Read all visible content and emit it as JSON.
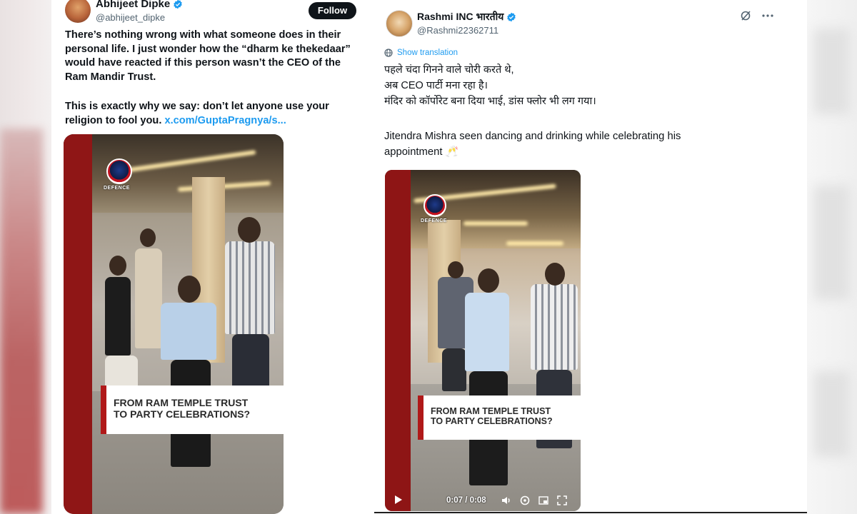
{
  "left_tweet": {
    "author_name": "Abhijeet Dipke",
    "handle": "@abhijeet_dipke",
    "follow_label": "Follow",
    "paragraph_1": "There’s nothing wrong with what someone does in their personal life. I just wonder how the “dharm ke thekedaar” would have reacted if this person wasn’t the CEO of the Ram Mandir Trust.",
    "paragraph_2": "This is exactly why we say: don’t let anyone use your religion to fool you.",
    "link": "x.com/GuptaPragnya/s...",
    "video": {
      "caption_line_1": "FROM RAM TEMPLE TRUST",
      "caption_line_2": "TO PARTY CELEBRATIONS?",
      "logo_text": "DEFENCE"
    }
  },
  "right_tweet": {
    "author_name": "Rashmi INC भारतीय",
    "handle": "@Rashmi22362711",
    "show_translation": "Show translation",
    "hindi_lines": [
      "पहले चंदा गिनने वाले चोरी करते थे,",
      "अब CEO पार्टी मना रहा है।",
      "मंदिर को कॉर्पोरेट बना दिया भाई, डांस फ्लोर भी लग गया।"
    ],
    "body_line_1": "Jitendra Mishra seen dancing and drinking while celebrating his",
    "body_line_2": "appointment 🥂",
    "video": {
      "caption_line_1": "FROM RAM TEMPLE TRUST",
      "caption_line_2": "TO PARTY CELEBRATIONS?",
      "logo_text": "DEFENCE",
      "time": "0:07 / 0:08"
    }
  },
  "icons": {
    "verified": "verified-badge-icon",
    "grok": "grok-icon",
    "more": "more-options-icon",
    "translate": "globe-icon",
    "play": "play-icon",
    "volume": "volume-icon",
    "settings": "settings-icon",
    "pip": "picture-in-picture-icon",
    "fullscreen": "fullscreen-icon"
  },
  "colors": {
    "link_blue": "#1d9bf0",
    "verified_blue": "#1d9bf0",
    "caption_red": "#b01919",
    "text_dark": "#0f1419",
    "text_muted": "#536471"
  }
}
